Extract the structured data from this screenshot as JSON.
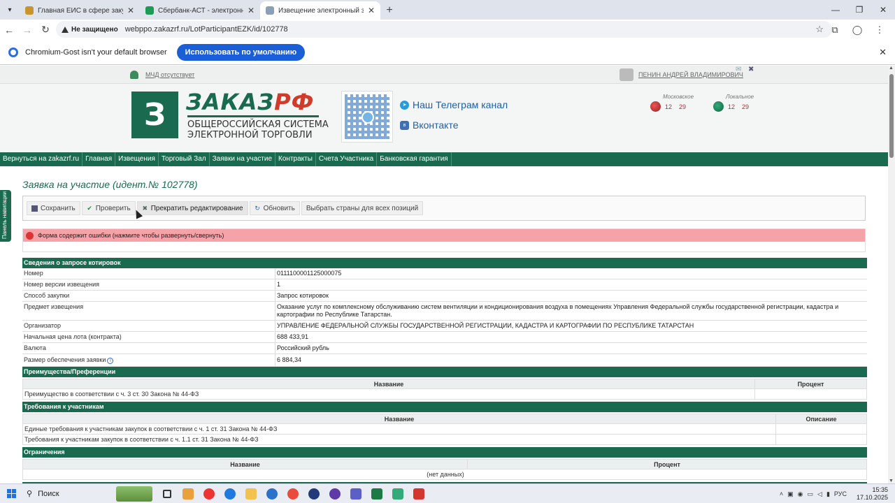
{
  "browser": {
    "tabs": [
      {
        "title": "Главная ЕИС в сфере закупок",
        "color": "#c9952a"
      },
      {
        "title": "Сбербанк-АСТ - электронная",
        "color": "#1e9a57"
      },
      {
        "title": "Извещение электронный запр",
        "color": "#8aa0b8"
      }
    ],
    "url": "webppo.zakazrf.ru/LotParticipantEZK/id/102778",
    "security_label": "Не защищено",
    "infobar_text": "Chromium-Gost isn't your default browser",
    "infobar_button": "Использовать по умолчанию"
  },
  "site": {
    "mchd": "МЧД отсутствует",
    "user": "ПЕНИН АНДРЕЙ ВЛАДИМИРОВИЧ",
    "logo_box": "З",
    "logo_name_a": "ЗАКАЗ",
    "logo_name_b": "РФ",
    "logo_sub_1": "ОБЩЕРОССИЙСКАЯ СИСТЕМА",
    "logo_sub_2": "ЭЛЕКТРОННОЙ ТОРГОВЛИ",
    "telegram": "Наш Телеграм канал",
    "vk": "Вконтакте",
    "clock_moscow": {
      "label": "Московское",
      "h": "12",
      "m": "29"
    },
    "clock_local": {
      "label": "Локальное",
      "h": "12",
      "m": "29"
    },
    "nav": [
      "Вернуться на zakazrf.ru",
      "Главная",
      "Извещения",
      "Торговый Зал",
      "Заявки на участие",
      "Контракты",
      "Счета Участника",
      "Банковская гарантия"
    ],
    "side_panel": "Панель навигации"
  },
  "page": {
    "title": "Заявка на участие (идент.№ 102778)",
    "toolbar": {
      "save": "Сохранить",
      "check": "Проверить",
      "stop_edit": "Прекратить редактирование",
      "refresh": "Обновить",
      "choose_countries": "Выбрать страны для всех позиций"
    },
    "error": "Форма содержит ошибки (нажмите чтобы развернуть/свернуть)"
  },
  "quote_info": {
    "heading": "Сведения о запросе котировок",
    "rows": [
      {
        "k": "Номер",
        "v": "0111100001125000075"
      },
      {
        "k": "Номер версии извещения",
        "v": "1"
      },
      {
        "k": "Способ закупки",
        "v": "Запрос котировок"
      },
      {
        "k": "Предмет извещения",
        "v": "Оказание услуг по комплексному обслуживанию систем вентиляции и кондиционирования воздуха в помещениях Управления Федеральной службы государственной регистрации, кадастра и картографии по Республике Татарстан."
      },
      {
        "k": "Организатор",
        "v": "УПРАВЛЕНИЕ ФЕДЕРАЛЬНОЙ СЛУЖБЫ ГОСУДАРСТВЕННОЙ РЕГИСТРАЦИИ, КАДАСТРА И КАРТОГРАФИИ ПО РЕСПУБЛИКЕ ТАТАРСТАН"
      },
      {
        "k": "Начальная цена лота (контракта)",
        "v": "688 433,91"
      },
      {
        "k": "Валюта",
        "v": "Российский рубль"
      },
      {
        "k": "Размер обеспечения заявки",
        "v": "6 884,34"
      }
    ]
  },
  "preferences": {
    "heading": "Преимущества/Преференции",
    "col_name": "Название",
    "col_pct": "Процент",
    "rows": [
      {
        "name": "Преимущество в соответствии с ч. 3 ст. 30 Закона № 44-ФЗ",
        "pct": ""
      }
    ]
  },
  "requirements": {
    "heading": "Требования к участникам",
    "col_name": "Название",
    "col_desc": "Описание",
    "rows": [
      {
        "name": "Единые требования к участникам закупок в соответствии с ч. 1 ст. 31 Закона № 44-ФЗ",
        "desc": ""
      },
      {
        "name": "Требования к участникам закупок в соответствии с ч. 1.1 ст. 31 Закона № 44-ФЗ",
        "desc": ""
      }
    ]
  },
  "restrictions": {
    "heading": "Ограничения",
    "col_name": "Название",
    "col_pct": "Процент",
    "empty": "(нет данных)"
  },
  "taskbar": {
    "search": "Поиск",
    "lang": "РУС",
    "time": "15:35",
    "date": "17.10.2025",
    "apps": [
      "#e9a13b",
      "#e33",
      "#1f7ae0",
      "#f2c14e",
      "#2a72c9",
      "#e94c3c",
      "#223a7a",
      "#5e3aa8",
      "#5b5fc7",
      "#1e7a44",
      "#3a7",
      "#d4352c"
    ]
  }
}
